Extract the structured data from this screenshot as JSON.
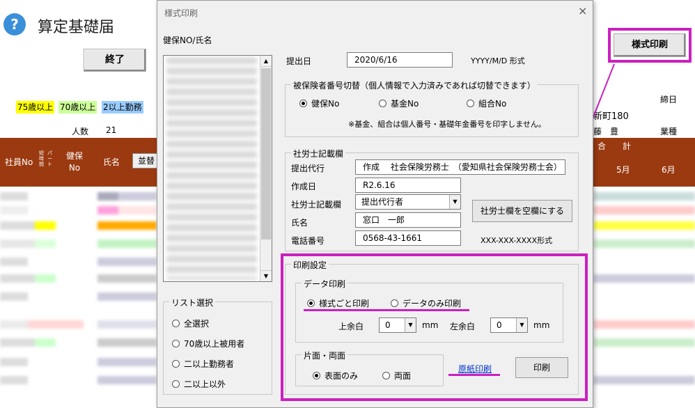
{
  "sheet": {
    "title": "算定基礎届",
    "help_icon": "?",
    "end_button": "終了",
    "legend": [
      "75歳以上",
      "70歳以上",
      "2以上勤務"
    ],
    "legend_colors": [
      "#ffff00",
      "#ccff99",
      "#99ccff"
    ],
    "count_label": "人数",
    "count_value": "21",
    "headers": {
      "emp_no": "社員No",
      "small": "短時間",
      "small2": "パート",
      "kenpo": "健保\nNo",
      "name": "氏名",
      "sort": "並替",
      "total_head": "合　　計",
      "month5": "5月",
      "month6": "6月"
    },
    "right_texts": {
      "shimebi": "締日",
      "town": "新町180",
      "person": "藤　豊",
      "industry": "業種"
    },
    "print_button": "様式印刷"
  },
  "dialog": {
    "title": "様式印刷",
    "close": "×",
    "list_caption": "健保NO/氏名",
    "submit_date_label": "提出日",
    "submit_date_value": "2020/6/16",
    "date_format": "YYYY/M/D 形式",
    "switch_group": {
      "caption": "被保険者番号切替（個人情報で入力済みであれば切替できます）",
      "options": [
        "健保No",
        "基金No",
        "組合No"
      ],
      "selected": 0,
      "note": "※基金、組合は個人番号・基礎年金番号を印字しません。"
    },
    "sharoushi_group": {
      "caption": "社労士記載欄",
      "proxy_label": "提出代行",
      "proxy_value": "作成　 社会保険労務士　（愛知県社会保険労務士会）",
      "created_label": "作成日",
      "created_value": "R2.6.16",
      "field_label": "社労士記載欄",
      "field_value": "提出代行者",
      "name_label": "氏名",
      "name_value": "窓口　一郎",
      "phone_label": "電話番号",
      "phone_value": "0568-43-1661",
      "phone_format": "XXX-XXX-XXXX形式",
      "clear_button": "社労士欄を空欄にする"
    },
    "list_select": {
      "caption": "リスト選択",
      "options": [
        "全選択",
        "70歳以上被用者",
        "二以上勤務者",
        "二以上以外"
      ]
    },
    "print_settings": {
      "caption": "印刷設定",
      "data_print": {
        "caption": "データ印刷",
        "options": [
          "様式ごと印刷",
          "データのみ印刷"
        ],
        "selected": 0,
        "top_margin_label": "上余白",
        "top_margin_value": "0",
        "left_margin_label": "左余白",
        "left_margin_value": "0",
        "unit": "mm"
      },
      "duplex": {
        "caption": "片面・両面",
        "options": [
          "表面のみ",
          "両面"
        ],
        "selected": 0
      },
      "original_print_link": "原紙印刷",
      "print_button": "印刷"
    }
  }
}
